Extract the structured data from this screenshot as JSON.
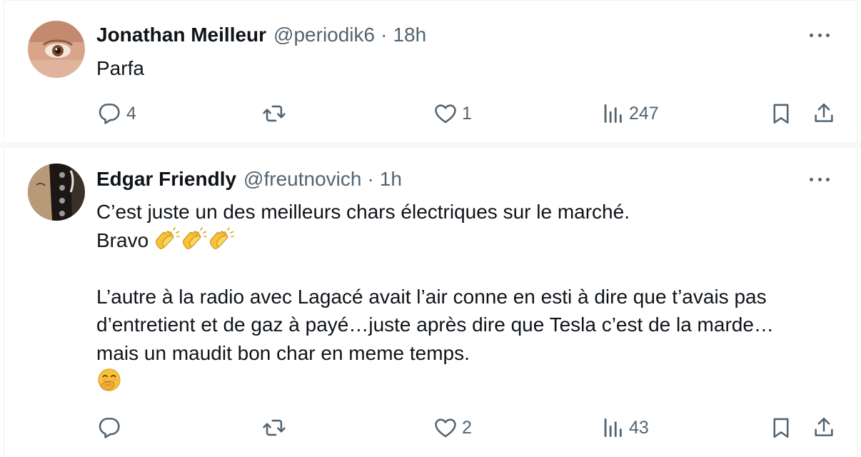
{
  "tweets": [
    {
      "author_name": "Jonathan Meilleur",
      "handle": "@periodik6",
      "separator": "·",
      "time": "18h",
      "text_lines": [
        "Parfa"
      ],
      "replies": "4",
      "retweets": "",
      "likes": "1",
      "views": "247"
    },
    {
      "author_name": "Edgar Friendly",
      "handle": "@freutnovich",
      "separator": "·",
      "time": "1h",
      "text_lines": [
        "C’est juste un des meilleurs chars électriques sur le marché.",
        "Bravo",
        "",
        "L’autre à la radio avec Lagacé avait l’air conne en esti à dire que t’avais pas",
        "d’entretient et de gaz à payé…juste après dire que Tesla c’est de la marde…",
        "mais un maudit bon char en meme temps."
      ],
      "replies": "",
      "retweets": "",
      "likes": "2",
      "views": "43"
    }
  ],
  "icons": {
    "reply": "reply-icon",
    "retweet": "retweet-icon",
    "like": "heart-icon",
    "views": "views-icon",
    "bookmark": "bookmark-icon",
    "share": "share-icon",
    "more": "more-icon",
    "clap": "clapping-hands-emoji",
    "giggle": "hand-over-mouth-emoji"
  },
  "colors": {
    "text": "#0f1419",
    "secondary": "#536471",
    "border": "#eff3f4",
    "emoji_yellow": "#f7c23a"
  }
}
